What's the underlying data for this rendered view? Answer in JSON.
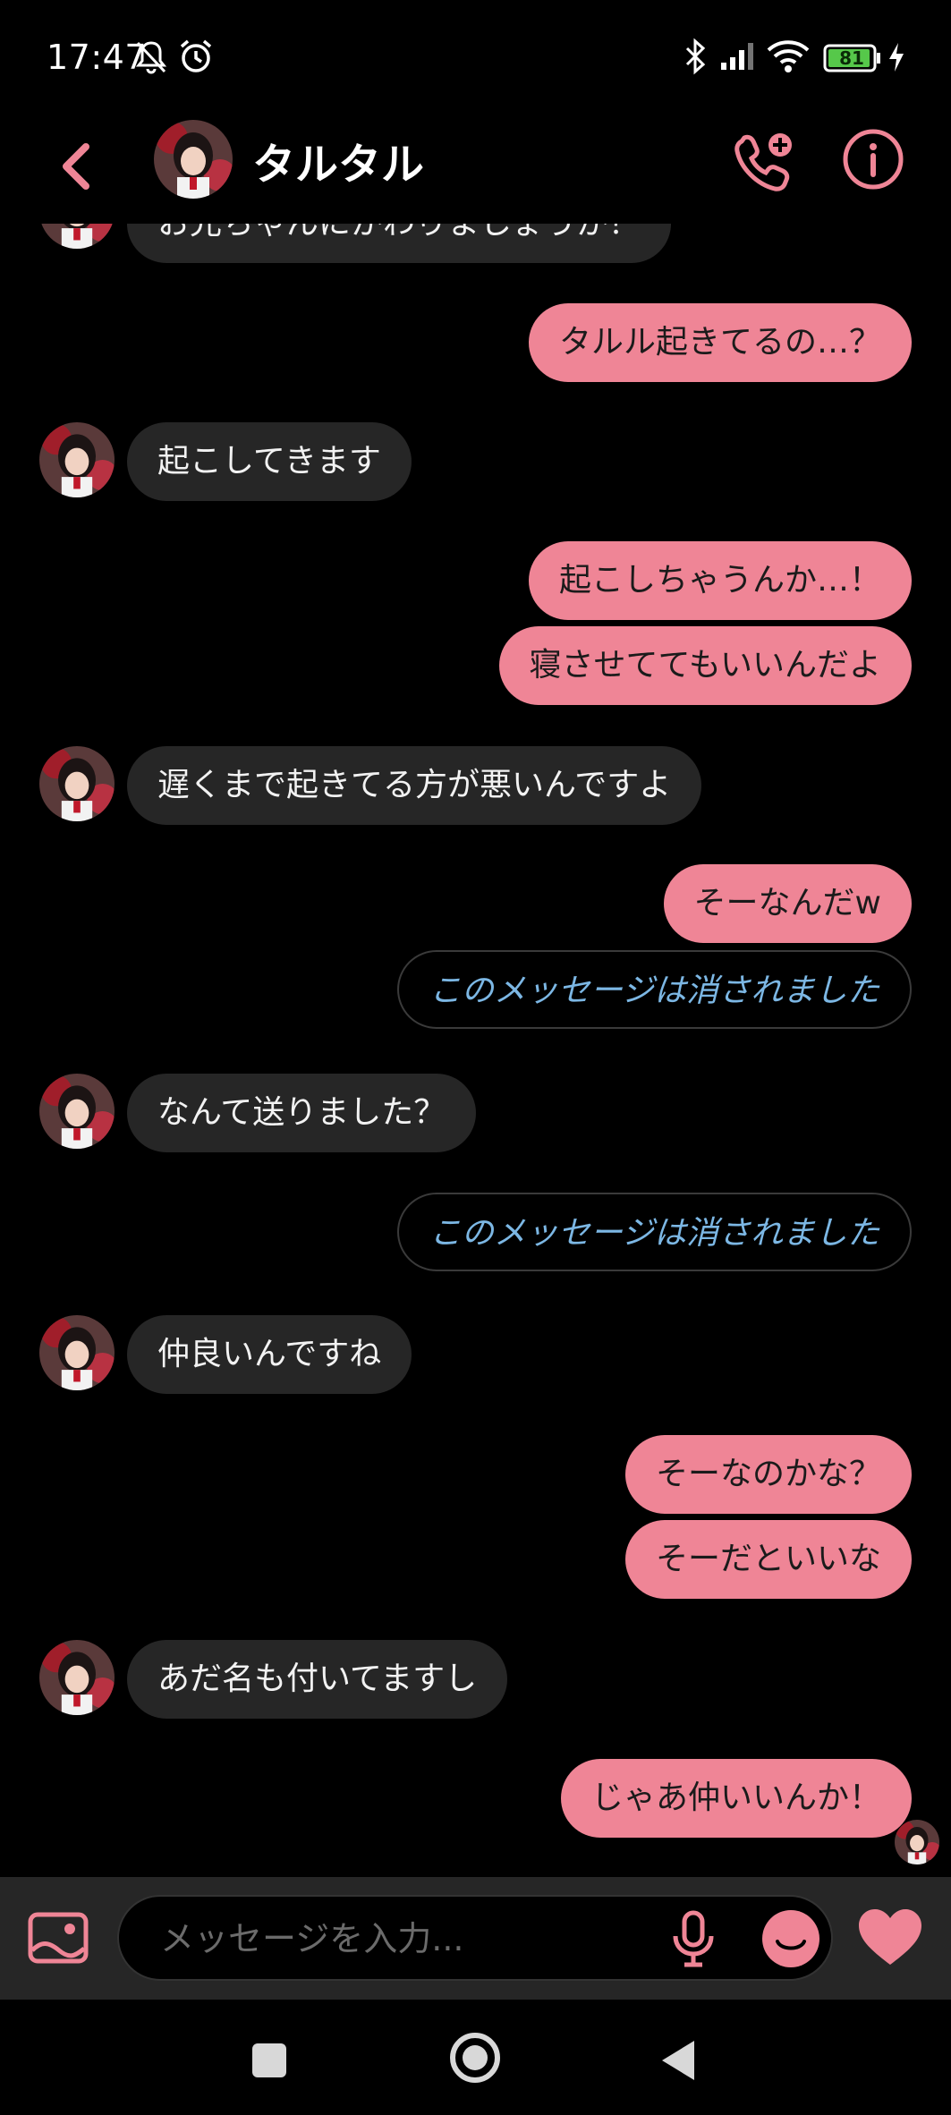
{
  "status_bar": {
    "time": "17:47",
    "battery": "81",
    "icons": [
      "bell-off-icon",
      "alarm-icon",
      "bluetooth-icon",
      "signal-icon",
      "wifi-icon",
      "battery-icon",
      "charging-icon"
    ]
  },
  "header": {
    "title": "タルタル",
    "icons": [
      "back-arrow-icon",
      "add-call-icon",
      "info-icon"
    ]
  },
  "colors": {
    "accent": "#ef8596",
    "incoming_bubble": "#262626",
    "deleted_text": "#7cb7e4"
  },
  "messages": [
    {
      "dir": "in",
      "text": "お兄ちゃんにかわりましょうか？"
    },
    {
      "dir": "out",
      "text": "タルル起きてるの…？"
    },
    {
      "dir": "in",
      "text": "起こしてきます"
    },
    {
      "dir": "out",
      "text": "起こしちゃうんか…！"
    },
    {
      "dir": "out",
      "text": "寝させててもいいんだよ"
    },
    {
      "dir": "in",
      "text": "遅くまで起きてる方が悪いんですよ"
    },
    {
      "dir": "out",
      "text": "そーなんだw"
    },
    {
      "dir": "out",
      "text": "このメッセージは消されました",
      "deleted": true
    },
    {
      "dir": "in",
      "text": "なんて送りました？"
    },
    {
      "dir": "out",
      "text": "このメッセージは消されました",
      "deleted": true
    },
    {
      "dir": "in",
      "text": "仲良いんですね"
    },
    {
      "dir": "out",
      "text": "そーなのかな？"
    },
    {
      "dir": "out",
      "text": "そーだといいな"
    },
    {
      "dir": "in",
      "text": "あだ名も付いてますし"
    },
    {
      "dir": "out",
      "text": "じゃあ仲いいんか！"
    }
  ],
  "composer": {
    "placeholder": "メッセージを入力...",
    "icons": [
      "gallery-icon",
      "mic-icon",
      "emoji-icon",
      "heart-icon"
    ]
  },
  "nav_bar": {
    "icons": [
      "recents-square-icon",
      "home-circle-icon",
      "back-triangle-icon"
    ]
  }
}
